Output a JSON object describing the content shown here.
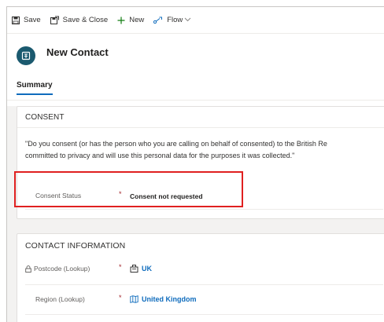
{
  "toolbar": {
    "save_label": "Save",
    "save_close_label": "Save & Close",
    "new_label": "New",
    "flow_label": "Flow"
  },
  "header": {
    "title": "New Contact",
    "tabs": [
      {
        "label": "Summary"
      }
    ]
  },
  "consent": {
    "section_title": "CONSENT",
    "text_line1": "\"Do you consent (or has the person who you are calling on behalf of consented) to the British Re",
    "text_line2": "committed to privacy and will use this personal data for the purposes it was collected.\"",
    "field_label": "Consent Status",
    "required_marker": "*",
    "field_value": "Consent not requested"
  },
  "contact_info": {
    "section_title": "CONTACT INFORMATION",
    "fields": [
      {
        "label": "Postcode (Lookup)",
        "required_marker": "*",
        "value": "UK",
        "locked": true
      },
      {
        "label": "Region (Lookup)",
        "required_marker": "*",
        "value": "United Kingdom",
        "locked": false
      }
    ]
  },
  "colors": {
    "accent": "#0f6cbd",
    "avatar": "#1b5a6f",
    "highlight": "#e02020",
    "required": "#a4262c"
  }
}
